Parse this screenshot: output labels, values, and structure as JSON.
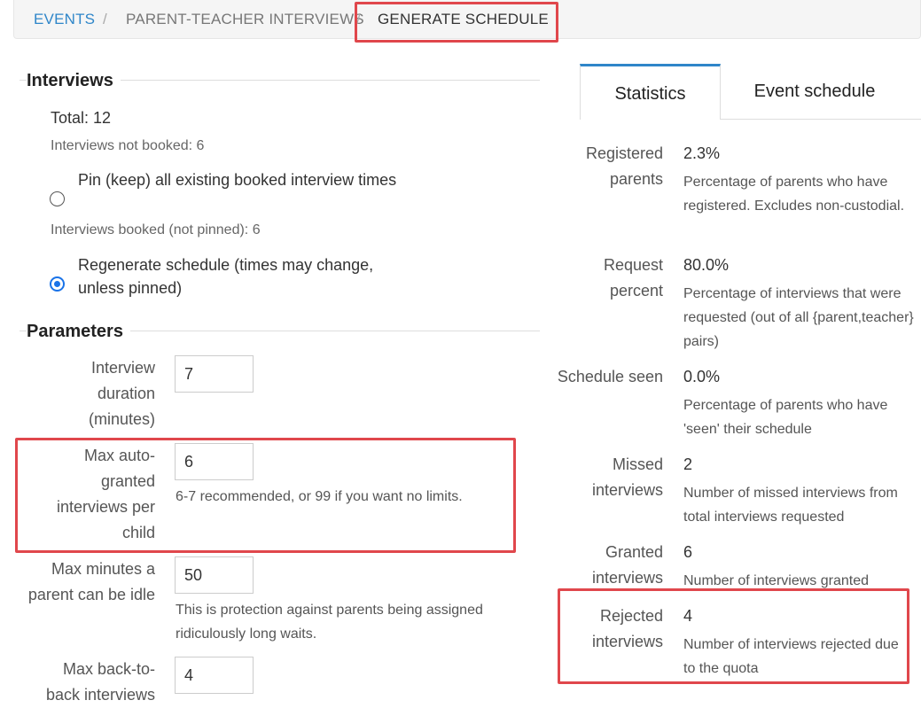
{
  "breadcrumb": {
    "items": [
      "EVENTS",
      "PARENT-TEACHER INTERVIEWS",
      "GENERATE SCHEDULE"
    ],
    "separator": "/"
  },
  "interviews": {
    "legend": "Interviews",
    "total": "Total: 12",
    "not_booked": "Interviews not booked: 6",
    "option_pin": "Pin (keep) all existing booked interview times",
    "booked_not_pinned": "Interviews booked (not pinned): 6",
    "option_regenerate": "Regenerate schedule (times may change, unless pinned)",
    "selected_option": "regenerate"
  },
  "parameters": {
    "legend": "Parameters",
    "fields": [
      {
        "label": "Interview duration (minutes)",
        "value": "7",
        "help": ""
      },
      {
        "label": "Max auto-granted interviews per child",
        "value": "6",
        "help": "6-7 recommended, or 99 if you want no limits."
      },
      {
        "label": "Max minutes a parent can be idle",
        "value": "50",
        "help": "This is protection against parents being assigned ridiculously long waits."
      },
      {
        "label": "Max back-to-back interviews",
        "value": "4",
        "help": ""
      }
    ]
  },
  "tabs": [
    "Statistics",
    "Event schedule"
  ],
  "active_tab": "Statistics",
  "statistics": [
    {
      "label": "Registered parents",
      "value": "2.3%",
      "desc": "Percentage of parents who have registered. Excludes non-custodial."
    },
    {
      "label": "Request percent",
      "value": "80.0%",
      "desc": "Percentage of interviews that were requested (out of all {parent,teacher} pairs)"
    },
    {
      "label": "Schedule seen",
      "value": "0.0%",
      "desc": "Percentage of parents who have 'seen' their schedule"
    },
    {
      "label": "Missed interviews",
      "value": "2",
      "desc": "Number of missed interviews from total interviews requested"
    },
    {
      "label": "Granted interviews",
      "value": "6",
      "desc": "Number of interviews granted"
    },
    {
      "label": "Rejected interviews",
      "value": "4",
      "desc": "Number of interviews rejected due to the quota"
    }
  ],
  "colors": {
    "link": "#2f86c9",
    "highlight": "#e0474c",
    "radio_checked": "#1a73e8"
  }
}
